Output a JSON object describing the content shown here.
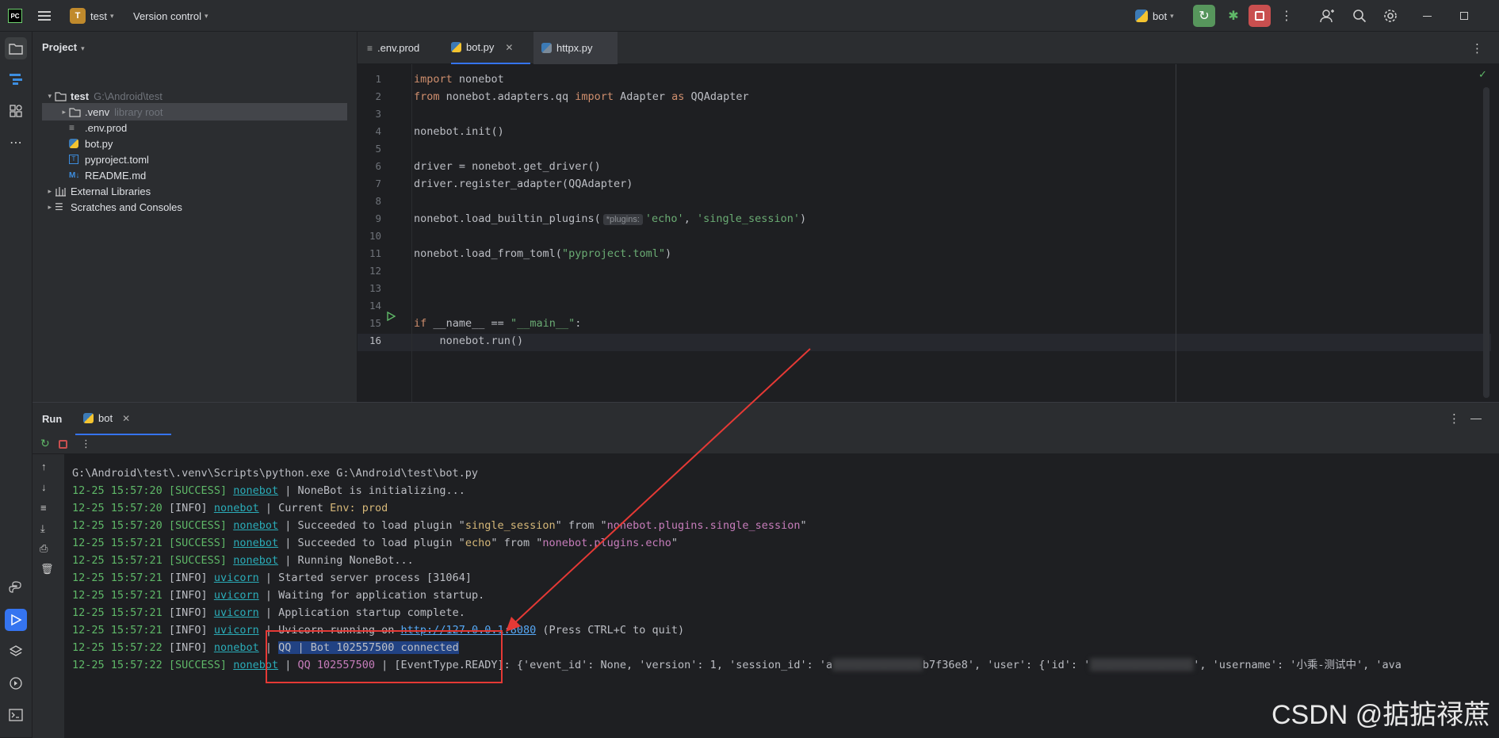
{
  "titlebar": {
    "logo": "PC",
    "project_badge": "T",
    "project_name": "test",
    "vcs": "Version control",
    "run_config": "bot"
  },
  "project_panel": {
    "title": "Project",
    "tree": [
      {
        "label": "test",
        "hint": "G:\\Android\\test",
        "level": 0,
        "expanded": true,
        "kind": "folder"
      },
      {
        "label": ".venv",
        "hint": "library root",
        "level": 1,
        "expanded": false,
        "kind": "folder",
        "selected": true
      },
      {
        "label": ".env.prod",
        "hint": "",
        "level": 1,
        "kind": "env"
      },
      {
        "label": "bot.py",
        "hint": "",
        "level": 1,
        "kind": "python"
      },
      {
        "label": "pyproject.toml",
        "hint": "",
        "level": 1,
        "kind": "toml"
      },
      {
        "label": "README.md",
        "hint": "",
        "level": 1,
        "kind": "md"
      },
      {
        "label": "External Libraries",
        "hint": "",
        "level": 0,
        "expanded": false,
        "kind": "lib"
      },
      {
        "label": "Scratches and Consoles",
        "hint": "",
        "level": 0,
        "expanded": false,
        "kind": "scratch"
      }
    ]
  },
  "editor": {
    "tabs": [
      {
        "label": ".env.prod",
        "active": false
      },
      {
        "label": "bot.py",
        "active": true
      },
      {
        "label": "httpx.py",
        "active": false
      }
    ],
    "lines": [
      [
        {
          "t": "import ",
          "c": "kw"
        },
        {
          "t": "nonebot",
          "c": "w"
        }
      ],
      [
        {
          "t": "from ",
          "c": "kw"
        },
        {
          "t": "nonebot.adapters.qq ",
          "c": "w"
        },
        {
          "t": "import ",
          "c": "kw"
        },
        {
          "t": "Adapter ",
          "c": "w"
        },
        {
          "t": "as ",
          "c": "kw"
        },
        {
          "t": "QQAdapter",
          "c": "w"
        }
      ],
      [],
      [
        {
          "t": "nonebot.init()",
          "c": "w"
        }
      ],
      [],
      [
        {
          "t": "driver = nonebot.get_driver()",
          "c": "w"
        }
      ],
      [
        {
          "t": "driver.register_adapter(QQAdapter)",
          "c": "w"
        }
      ],
      [],
      [
        {
          "t": "nonebot.load_builtin_plugins(",
          "c": "w"
        },
        {
          "t": "*plugins:",
          "c": "hint"
        },
        {
          "t": "'echo'",
          "c": "str"
        },
        {
          "t": ", ",
          "c": "w"
        },
        {
          "t": "'single_session'",
          "c": "str"
        },
        {
          "t": ")",
          "c": "w"
        }
      ],
      [],
      [
        {
          "t": "nonebot.load_from_toml(",
          "c": "w"
        },
        {
          "t": "\"pyproject.toml\"",
          "c": "str"
        },
        {
          "t": ")",
          "c": "w"
        }
      ],
      [],
      [],
      [],
      [
        {
          "t": "if ",
          "c": "kw"
        },
        {
          "t": "__name__ == ",
          "c": "w"
        },
        {
          "t": "\"__main__\"",
          "c": "str"
        },
        {
          "t": ":",
          "c": "w"
        }
      ],
      [
        {
          "t": "    nonebot.run()",
          "c": "w"
        }
      ]
    ]
  },
  "run_panel": {
    "title": "Run",
    "tab": "bot",
    "command": "G:\\Android\\test\\.venv\\Scripts\\python.exe G:\\Android\\test\\bot.py",
    "log": [
      [
        {
          "t": "12-25 15:57:20 [",
          "c": "g"
        },
        {
          "t": "SUCCESS",
          "c": "g"
        },
        {
          "t": "] ",
          "c": "g"
        },
        {
          "t": "nonebot",
          "c": "nb"
        },
        {
          "t": " | NoneBot is initializing...",
          "c": "w"
        }
      ],
      [
        {
          "t": "12-25 15:57:20 ",
          "c": "g"
        },
        {
          "t": "[INFO] ",
          "c": "w"
        },
        {
          "t": "nonebot",
          "c": "nb"
        },
        {
          "t": " | Current ",
          "c": "w"
        },
        {
          "t": "Env: prod",
          "c": "y"
        }
      ],
      [
        {
          "t": "12-25 15:57:20 [SUCCESS] ",
          "c": "g"
        },
        {
          "t": "nonebot",
          "c": "nb"
        },
        {
          "t": " | Succeeded to load plugin \"",
          "c": "w"
        },
        {
          "t": "single_session",
          "c": "y"
        },
        {
          "t": "\" from \"",
          "c": "w"
        },
        {
          "t": "nonebot.plugins.single_session",
          "c": "p"
        },
        {
          "t": "\"",
          "c": "w"
        }
      ],
      [
        {
          "t": "12-25 15:57:21 [SUCCESS] ",
          "c": "g"
        },
        {
          "t": "nonebot",
          "c": "nb"
        },
        {
          "t": " | Succeeded to load plugin \"",
          "c": "w"
        },
        {
          "t": "echo",
          "c": "y"
        },
        {
          "t": "\" from \"",
          "c": "w"
        },
        {
          "t": "nonebot.plugins.echo",
          "c": "p"
        },
        {
          "t": "\"",
          "c": "w"
        }
      ],
      [
        {
          "t": "12-25 15:57:21 [SUCCESS] ",
          "c": "g"
        },
        {
          "t": "nonebot",
          "c": "nb"
        },
        {
          "t": " | Running NoneBot...",
          "c": "w"
        }
      ],
      [
        {
          "t": "12-25 15:57:21 ",
          "c": "g"
        },
        {
          "t": "[INFO] ",
          "c": "w"
        },
        {
          "t": "uvicorn",
          "c": "nb"
        },
        {
          "t": " | Started server process [31064]",
          "c": "w"
        }
      ],
      [
        {
          "t": "12-25 15:57:21 ",
          "c": "g"
        },
        {
          "t": "[INFO] ",
          "c": "w"
        },
        {
          "t": "uvicorn",
          "c": "nb"
        },
        {
          "t": " | Waiting for application startup.",
          "c": "w"
        }
      ],
      [
        {
          "t": "12-25 15:57:21 ",
          "c": "g"
        },
        {
          "t": "[INFO] ",
          "c": "w"
        },
        {
          "t": "uvicorn",
          "c": "nb"
        },
        {
          "t": " | Application startup complete.",
          "c": "w"
        }
      ],
      [
        {
          "t": "12-25 15:57:21 ",
          "c": "g"
        },
        {
          "t": "[INFO] ",
          "c": "w"
        },
        {
          "t": "uvicorn",
          "c": "nb"
        },
        {
          "t": " | Uvicorn running on ",
          "c": "w"
        },
        {
          "t": "http://127.0.0.1:8080",
          "c": "lk"
        },
        {
          "t": " (Press CTRL+C to quit)",
          "c": "w"
        }
      ],
      [
        {
          "t": "12-25 15:57:22 ",
          "c": "g"
        },
        {
          "t": "[INFO] ",
          "c": "w"
        },
        {
          "t": "nonebot",
          "c": "nb"
        },
        {
          "t": " | ",
          "c": "w"
        },
        {
          "t": "QQ | Bot 102557500 connected",
          "c": "sel"
        }
      ],
      [
        {
          "t": "12-25 15:57:22 [SUCCESS] ",
          "c": "g"
        },
        {
          "t": "nonebot",
          "c": "nb"
        },
        {
          "t": " | ",
          "c": "w"
        },
        {
          "t": "QQ 102557500",
          "c": "p"
        },
        {
          "t": " | [EventType.READY]: {'event_id': None, 'version': 1, 'session_id': 'a",
          "c": "w"
        },
        {
          "t": "██████████████",
          "c": "blur"
        },
        {
          "t": "b7f36e8', 'user': {'id': '",
          "c": "w"
        },
        {
          "t": "████████████████",
          "c": "blur"
        },
        {
          "t": "', 'username': '小乘-测试中', 'ava",
          "c": "w"
        }
      ]
    ]
  },
  "watermark": "CSDN @掂掂禄蔗",
  "colors": {
    "accent": "#3574f0",
    "annotation": "#e53935",
    "run_green": "#5fb868"
  }
}
